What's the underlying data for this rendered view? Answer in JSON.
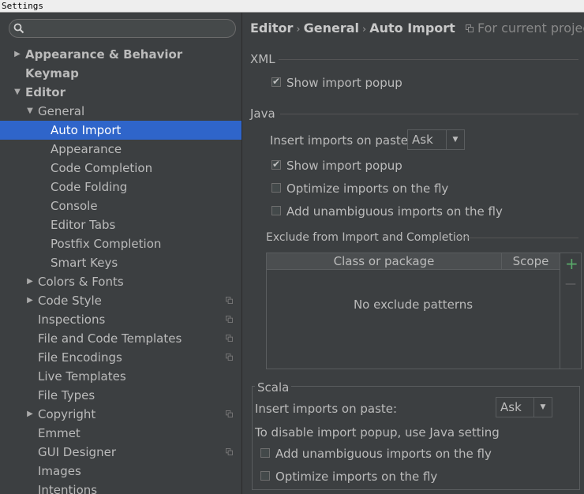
{
  "window": {
    "title": "Settings"
  },
  "sidebar": {
    "search_placeholder": "",
    "items": [
      {
        "label": "Appearance & Behavior",
        "level": 0,
        "arrow": "right",
        "bold": true
      },
      {
        "label": "Keymap",
        "level": 0,
        "arrow": "",
        "bold": true
      },
      {
        "label": "Editor",
        "level": 0,
        "arrow": "down",
        "bold": true
      },
      {
        "label": "General",
        "level": 1,
        "arrow": "down"
      },
      {
        "label": "Auto Import",
        "level": 2,
        "arrow": "",
        "selected": true
      },
      {
        "label": "Appearance",
        "level": 2,
        "arrow": ""
      },
      {
        "label": "Code Completion",
        "level": 2,
        "arrow": ""
      },
      {
        "label": "Code Folding",
        "level": 2,
        "arrow": ""
      },
      {
        "label": "Console",
        "level": 2,
        "arrow": ""
      },
      {
        "label": "Editor Tabs",
        "level": 2,
        "arrow": ""
      },
      {
        "label": "Postfix Completion",
        "level": 2,
        "arrow": ""
      },
      {
        "label": "Smart Keys",
        "level": 2,
        "arrow": ""
      },
      {
        "label": "Colors & Fonts",
        "level": 1,
        "arrow": "right"
      },
      {
        "label": "Code Style",
        "level": 1,
        "arrow": "right",
        "project": true
      },
      {
        "label": "Inspections",
        "level": 1,
        "arrow": "",
        "project": true
      },
      {
        "label": "File and Code Templates",
        "level": 1,
        "arrow": "",
        "project": true
      },
      {
        "label": "File Encodings",
        "level": 1,
        "arrow": "",
        "project": true
      },
      {
        "label": "Live Templates",
        "level": 1,
        "arrow": ""
      },
      {
        "label": "File Types",
        "level": 1,
        "arrow": ""
      },
      {
        "label": "Copyright",
        "level": 1,
        "arrow": "right",
        "project": true
      },
      {
        "label": "Emmet",
        "level": 1,
        "arrow": ""
      },
      {
        "label": "GUI Designer",
        "level": 1,
        "arrow": "",
        "project": true
      },
      {
        "label": "Images",
        "level": 1,
        "arrow": ""
      },
      {
        "label": "Intentions",
        "level": 1,
        "arrow": ""
      }
    ]
  },
  "breadcrumb": {
    "parts": [
      "Editor",
      "General",
      "Auto Import"
    ],
    "separator": "›",
    "hint": "For current project"
  },
  "xml": {
    "title": "XML",
    "show_popup": {
      "label": "Show import popup",
      "checked": true
    }
  },
  "java": {
    "title": "Java",
    "insert_label": "Insert imports on paste:",
    "insert_value": "Ask",
    "show_popup": {
      "label": "Show import popup",
      "checked": true
    },
    "optimize": {
      "label": "Optimize imports on the fly",
      "checked": false
    },
    "add_unambiguous": {
      "label": "Add unambiguous imports on the fly",
      "checked": false
    },
    "exclude_title": "Exclude from Import and Completion",
    "table": {
      "col_class": "Class or package",
      "col_scope": "Scope",
      "empty": "No exclude patterns"
    },
    "add_symbol": "+",
    "remove_symbol": "—"
  },
  "scala": {
    "title": "Scala",
    "insert_label": "Insert imports on paste:",
    "insert_value": "Ask",
    "note": "To disable import popup, use Java setting",
    "add_unambiguous": {
      "label": "Add unambiguous imports on the fly",
      "checked": false
    },
    "optimize": {
      "label": "Optimize imports on the fly",
      "checked": false
    }
  },
  "colors": {
    "background": "#3c3f41",
    "selection": "#2f65ca",
    "add_green": "#59a869"
  },
  "icons": {
    "search": "search-icon",
    "project_scope": "project-settings-icon",
    "tree_expand": "chevron-right-icon",
    "tree_collapse": "chevron-down-icon"
  }
}
